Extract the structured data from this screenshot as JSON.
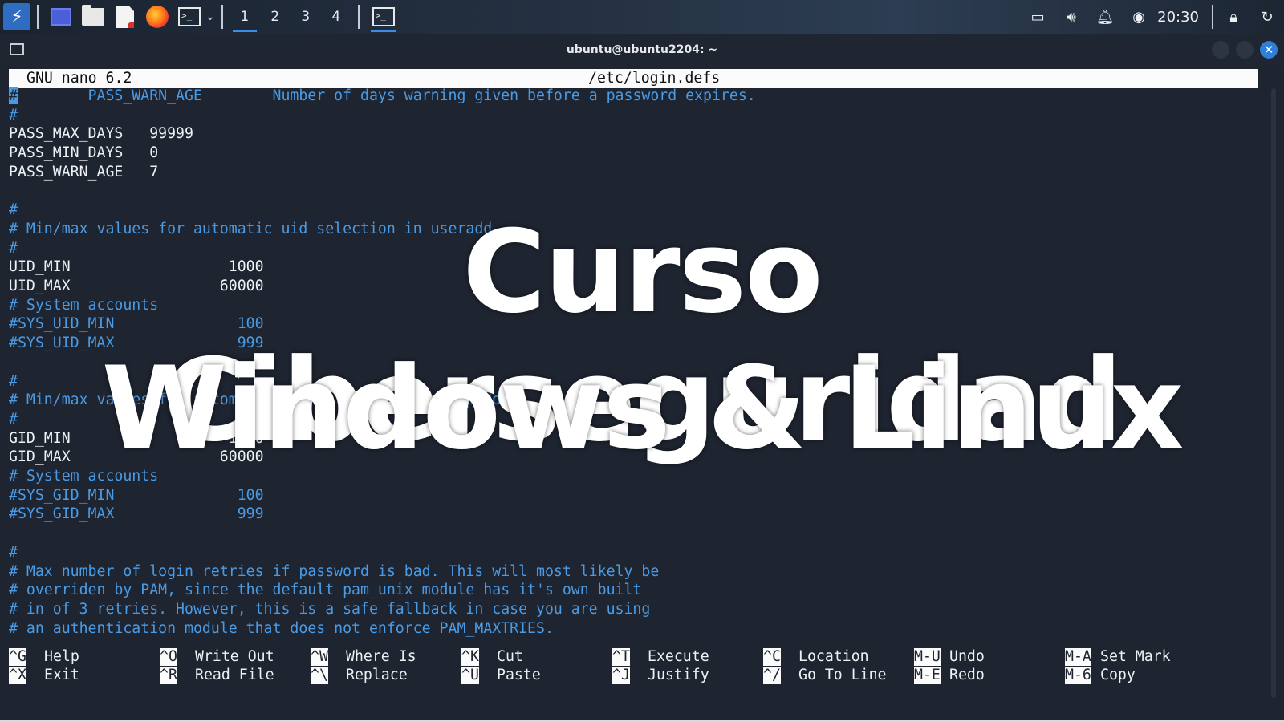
{
  "taskbar": {
    "workspaces": [
      "1",
      "2",
      "3",
      "4"
    ],
    "clock": "20:30",
    "terminal_glyph": ">_"
  },
  "window": {
    "title": "ubuntu@ubuntu2204: ~"
  },
  "nano": {
    "version": "GNU nano 6.2",
    "filename": "/etc/login.defs",
    "lines": [
      {
        "text": "#\tPASS_WARN_AGE\tNumber of days warning given before a password expires.",
        "comment": true
      },
      {
        "text": "#",
        "comment": true
      },
      {
        "text": "PASS_MAX_DAYS   99999",
        "comment": false
      },
      {
        "text": "PASS_MIN_DAYS   0",
        "comment": false
      },
      {
        "text": "PASS_WARN_AGE   7",
        "comment": false
      },
      {
        "text": "",
        "comment": false
      },
      {
        "text": "#",
        "comment": true
      },
      {
        "text": "# Min/max values for automatic uid selection in useradd",
        "comment": true
      },
      {
        "text": "#",
        "comment": true
      },
      {
        "text": "UID_MIN                  1000",
        "comment": false
      },
      {
        "text": "UID_MAX                 60000",
        "comment": false
      },
      {
        "text": "# System accounts",
        "comment": true
      },
      {
        "text": "#SYS_UID_MIN              100",
        "comment": true
      },
      {
        "text": "#SYS_UID_MAX              999",
        "comment": true
      },
      {
        "text": "",
        "comment": false
      },
      {
        "text": "#",
        "comment": true
      },
      {
        "text": "# Min/max values for automatic gid selection in groupadd",
        "comment": true
      },
      {
        "text": "#",
        "comment": true
      },
      {
        "text": "GID_MIN                  1000",
        "comment": false
      },
      {
        "text": "GID_MAX                 60000",
        "comment": false
      },
      {
        "text": "# System accounts",
        "comment": true
      },
      {
        "text": "#SYS_GID_MIN              100",
        "comment": true
      },
      {
        "text": "#SYS_GID_MAX              999",
        "comment": true
      },
      {
        "text": "",
        "comment": false
      },
      {
        "text": "#",
        "comment": true
      },
      {
        "text": "# Max number of login retries if password is bad. This will most likely be",
        "comment": true
      },
      {
        "text": "# overriden by PAM, since the default pam_unix module has it's own built",
        "comment": true
      },
      {
        "text": "# in of 3 retries. However, this is a safe fallback in case you are using",
        "comment": true
      },
      {
        "text": "# an authentication module that does not enforce PAM_MAXTRIES.",
        "comment": true
      }
    ],
    "shortcuts": [
      {
        "key": "^G",
        "label": "Help"
      },
      {
        "key": "^X",
        "label": "Exit"
      },
      {
        "key": "^O",
        "label": "Write Out"
      },
      {
        "key": "^R",
        "label": "Read File"
      },
      {
        "key": "^W",
        "label": "Where Is"
      },
      {
        "key": "^\\",
        "label": "Replace"
      },
      {
        "key": "^K",
        "label": "Cut"
      },
      {
        "key": "^U",
        "label": "Paste"
      },
      {
        "key": "^T",
        "label": "Execute"
      },
      {
        "key": "^J",
        "label": "Justify"
      },
      {
        "key": "^C",
        "label": "Location"
      },
      {
        "key": "^/",
        "label": "Go To Line"
      },
      {
        "key": "M-U",
        "label": "Undo"
      },
      {
        "key": "M-E",
        "label": "Redo"
      },
      {
        "key": "M-A",
        "label": "Set Mark"
      },
      {
        "key": "M-6",
        "label": "Copy"
      }
    ]
  },
  "overlay": {
    "line1": "Curso Ciberseguridad",
    "line2": "Windows & Linux"
  }
}
